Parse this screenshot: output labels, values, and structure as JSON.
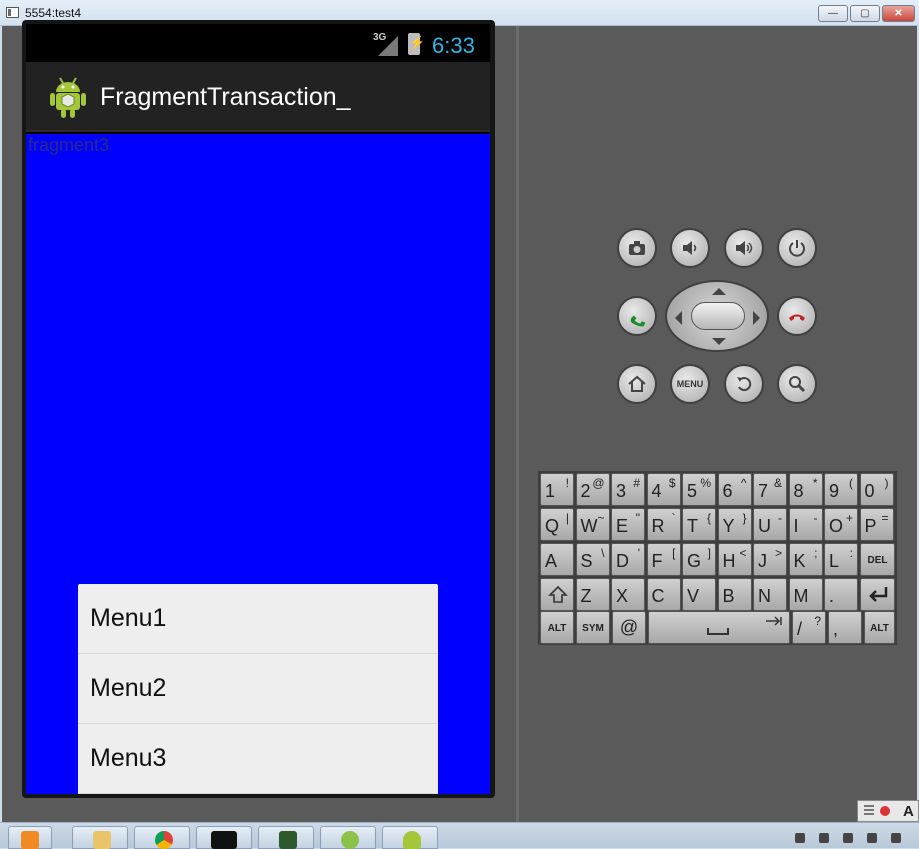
{
  "window": {
    "title": "5554:test4",
    "min_label": "—",
    "max_label": "▢",
    "close_label": "✕"
  },
  "device": {
    "status": {
      "network": "3G",
      "clock": "6:33",
      "clock_color": "#33b5e5",
      "battery_symbol": "⚡"
    },
    "action_bar": {
      "title": "FragmentTransaction_",
      "icon": "android-robot-icon"
    },
    "content": {
      "background": "#0000ff",
      "fragment_label": "fragment3"
    },
    "popup_menu": {
      "items": [
        "Menu1",
        "Menu2",
        "Menu3"
      ]
    }
  },
  "controls": {
    "buttons": [
      "camera-icon",
      "volume-down-icon",
      "volume-up-icon",
      "power-icon",
      "call-icon",
      "dpad",
      "end-call-icon",
      "home-icon",
      "menu-button",
      "back-icon",
      "search-icon"
    ],
    "menu_label": "MENU"
  },
  "keyboard": {
    "row1": [
      [
        "1",
        "!"
      ],
      [
        "2",
        "@"
      ],
      [
        "3",
        "#"
      ],
      [
        "4",
        "$"
      ],
      [
        "5",
        "%"
      ],
      [
        "6",
        "^"
      ],
      [
        "7",
        "&"
      ],
      [
        "8",
        "*"
      ],
      [
        "9",
        "("
      ],
      [
        "0",
        ")"
      ]
    ],
    "row2": [
      [
        "Q",
        "|"
      ],
      [
        "W",
        "~"
      ],
      [
        "E",
        "\""
      ],
      [
        "R",
        "`"
      ],
      [
        "T",
        "{"
      ],
      [
        "Y",
        "}"
      ],
      [
        "U",
        "-"
      ],
      [
        "I",
        "-"
      ],
      [
        "O",
        "+"
      ],
      [
        "P",
        "="
      ]
    ],
    "row3": [
      [
        "A",
        ""
      ],
      [
        "S",
        "\\"
      ],
      [
        "D",
        "'"
      ],
      [
        "F",
        "["
      ],
      [
        "G",
        "]"
      ],
      [
        "H",
        "<"
      ],
      [
        "J",
        ">"
      ],
      [
        "K",
        ";"
      ],
      [
        "L",
        ":"
      ]
    ],
    "row3_del": "DEL",
    "row4": [
      [
        "Z",
        ""
      ],
      [
        "X",
        ""
      ],
      [
        "C",
        ""
      ],
      [
        "V",
        ""
      ],
      [
        "B",
        ""
      ],
      [
        "N",
        ""
      ],
      [
        "M",
        ""
      ],
      [
        ".",
        ""
      ]
    ],
    "row5": {
      "alt_left": "ALT",
      "sym": "SYM",
      "at": "@",
      "slash": "/",
      "question": "?",
      "comma": ",",
      "alt_right": "ALT"
    }
  },
  "taskbar": {
    "apps": [
      "media-player-icon",
      "file-explorer-icon",
      "chrome-icon",
      "cmd-icon",
      "monitor-icon",
      "braces-app-icon",
      "android-icon"
    ],
    "lang_label": "A"
  }
}
